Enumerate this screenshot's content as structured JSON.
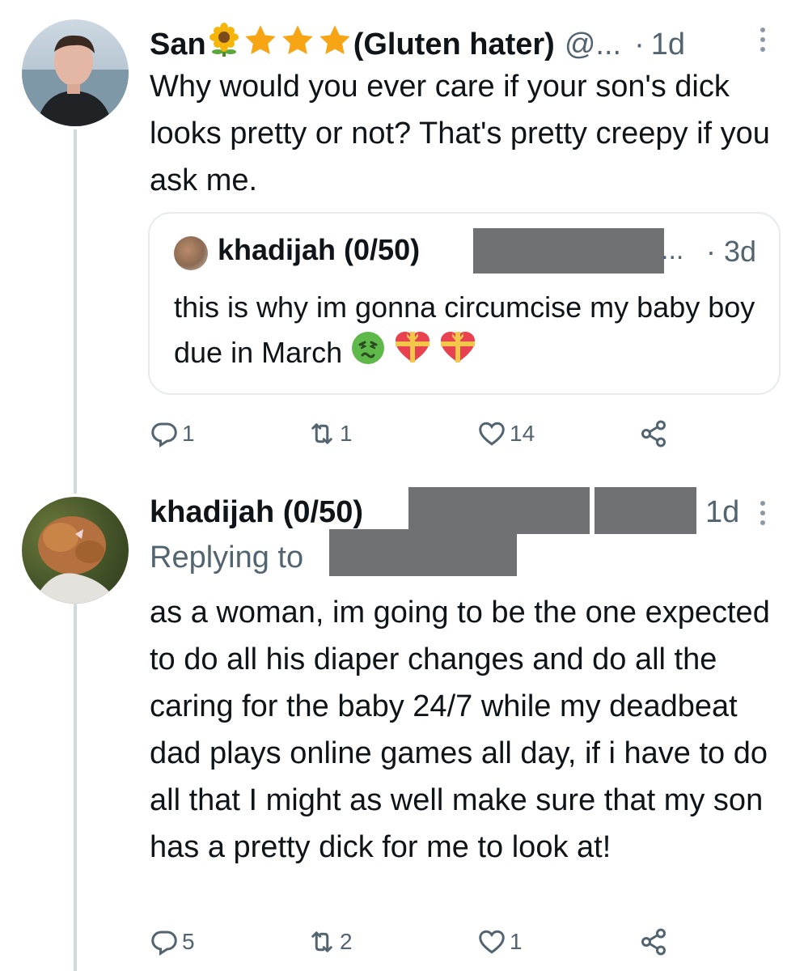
{
  "tweets": [
    {
      "display_name": "San",
      "display_name_suffix": "(Gluten hater)",
      "handle": "@...",
      "time": "1d",
      "text": "Why would you ever care if your son's dick looks pretty or not? That's pretty creepy if you ask me.",
      "quote": {
        "display_name": "khadijah (0/50)",
        "handle": "...",
        "time": "3d",
        "text": "this is why im gonna circumcise my baby boy due in March"
      },
      "actions": {
        "replies": "1",
        "retweets": "1",
        "likes": "14"
      }
    },
    {
      "display_name": "khadijah (0/50)",
      "time": "1d",
      "replying_to_label": "Replying to",
      "text": "as a woman, im going to be the one expected to do all his diaper changes and do all the caring for the baby 24/7 while my deadbeat dad plays online games all day, if i have to do all that I might as well make sure that my son has a pretty dick for me to look at!",
      "actions": {
        "replies": "5",
        "retweets": "2",
        "likes": "1"
      }
    }
  ],
  "colors": {
    "text": "#0f1419",
    "secondary": "#536471",
    "thread_line": "#cfd9de",
    "redaction": "#6f7173",
    "star": "#f7a415"
  },
  "icons": [
    "reply-icon",
    "retweet-icon",
    "like-icon",
    "share-icon",
    "more-icon",
    "sunflower-icon",
    "star-icon",
    "nauseated-face-icon",
    "heart-ribbon-icon"
  ]
}
